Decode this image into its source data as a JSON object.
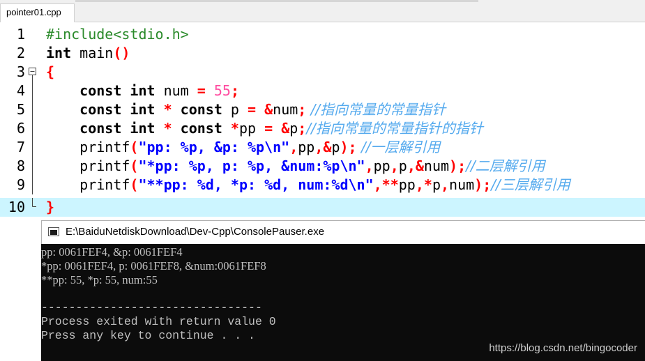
{
  "tab": {
    "label": "pointer01.cpp"
  },
  "editor": {
    "lines": [
      {
        "n": "1"
      },
      {
        "n": "2"
      },
      {
        "n": "3"
      },
      {
        "n": "4"
      },
      {
        "n": "5"
      },
      {
        "n": "6"
      },
      {
        "n": "7"
      },
      {
        "n": "8"
      },
      {
        "n": "9"
      },
      {
        "n": "10"
      }
    ],
    "l1": {
      "pp": "#include<stdio.h>"
    },
    "l2": {
      "kw": "int",
      "name": " main",
      "paren": "()"
    },
    "l3": {
      "brace": "{"
    },
    "l4": {
      "indent": "    ",
      "kw": "const int",
      "var": " num ",
      "eq": "=",
      "num": " 55",
      "semi": ";"
    },
    "l5": {
      "indent": "    ",
      "kw1": "const int",
      "star": " *",
      "kw2": " const",
      "var": " p ",
      "eq": "=",
      "amp": " &",
      "name": "num",
      "semi": ";",
      "cm": " //指向常量的常量指针"
    },
    "l6": {
      "indent": "    ",
      "kw1": "const int",
      "star": " *",
      "kw2": " const",
      "star2": " *",
      "var": "pp ",
      "eq": "=",
      "amp": " &",
      "name": "p",
      "semi": ";",
      "cm": "//指向常量的常量指针的指针"
    },
    "l7": {
      "indent": "    ",
      "fn": "printf",
      "open": "(",
      "str": "\"pp: %p, &p: %p\\n\"",
      "c1": ",",
      "a1": "pp",
      "c2": ",",
      "amp": "&",
      "a2": "p",
      "close": ");",
      "cm": " //一层解引用"
    },
    "l8": {
      "indent": "    ",
      "fn": "printf",
      "open": "(",
      "str": "\"*pp: %p, p: %p, &num:%p\\n\"",
      "c1": ",",
      "a1": "pp",
      "c2": ",",
      "a2": "p",
      "c3": ",",
      "amp": "&",
      "a3": "num",
      "close": ");",
      "cm": "//二层解引用"
    },
    "l9": {
      "indent": "    ",
      "fn": "printf",
      "open": "(",
      "str": "\"**pp: %d, *p: %d, num:%d\\n\"",
      "c1": ",",
      "st1": "**",
      "a1": "pp",
      "c2": ",",
      "st2": "*",
      "a2": "p",
      "c3": ",",
      "a3": "num",
      "close": ");",
      "cm": "//三层解引用"
    },
    "l10": {
      "brace": "}"
    }
  },
  "console": {
    "title": "E:\\BaiduNetdiskDownload\\Dev-Cpp\\ConsolePauser.exe",
    "output": [
      "pp: 0061FEF4, &p: 0061FEF4",
      "*pp: 0061FEF4, p: 0061FEF8, &num:0061FEF8",
      "**pp: 55, *p: 55, num:55",
      "",
      "--------------------------------",
      "Process exited with return value 0",
      "Press any key to continue . . ."
    ]
  },
  "watermark": "https://blog.csdn.net/bingocoder"
}
